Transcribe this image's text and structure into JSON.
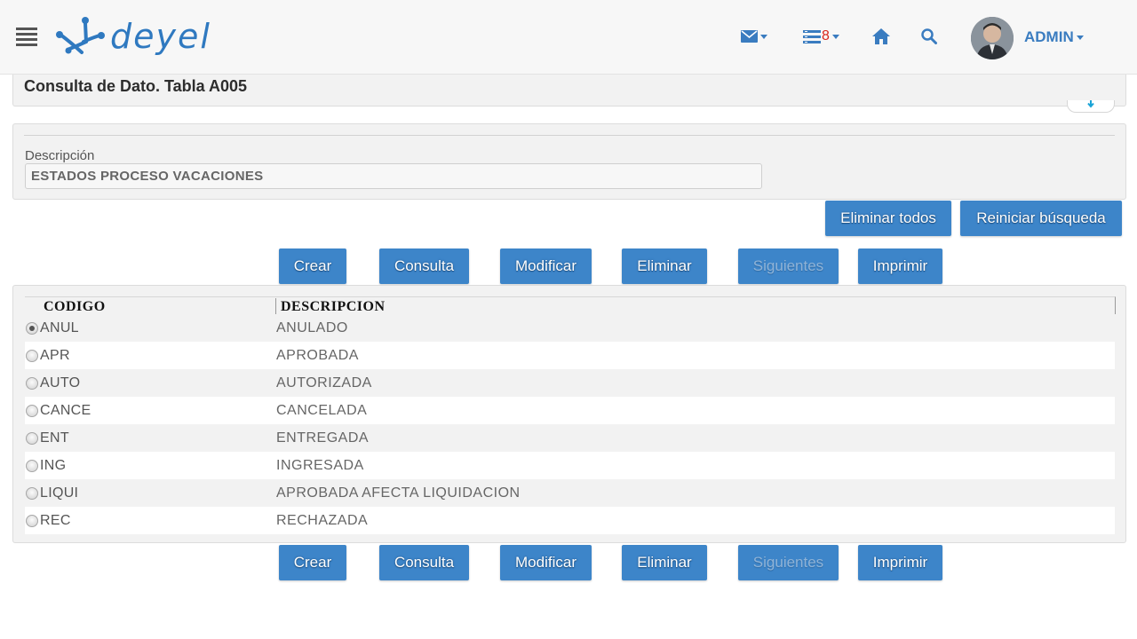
{
  "header": {
    "brand": "deyel",
    "messages_icon": "envelope-icon",
    "tasks_icon": "list-icon",
    "tasks_count": "8",
    "home_icon": "home-icon",
    "search_icon": "search-icon",
    "user_name": "ADMIN"
  },
  "page": {
    "title": "Consulta de Dato. Tabla A005"
  },
  "filter": {
    "label": "Descripción",
    "value": "ESTADOS PROCESO VACACIONES"
  },
  "filter_actions": {
    "delete_all": "Eliminar todos",
    "reset_search": "Reiniciar búsqueda"
  },
  "toolbar": {
    "create": "Crear",
    "query": "Consulta",
    "modify": "Modificar",
    "delete": "Eliminar",
    "next": "Siguientes",
    "print": "Imprimir"
  },
  "grid": {
    "columns": [
      "CODIGO",
      "DESCRIPCION"
    ],
    "selected_index": 0,
    "rows": [
      {
        "code": "ANUL",
        "description": "ANULADO"
      },
      {
        "code": "APR",
        "description": "APROBADA"
      },
      {
        "code": "AUTO",
        "description": "AUTORIZADA"
      },
      {
        "code": "CANCE",
        "description": "CANCELADA"
      },
      {
        "code": "ENT",
        "description": "ENTREGADA"
      },
      {
        "code": "ING",
        "description": "INGRESADA"
      },
      {
        "code": "LIQUI",
        "description": "APROBADA AFECTA LIQUIDACION"
      },
      {
        "code": "REC",
        "description": "RECHAZADA"
      }
    ]
  },
  "colors": {
    "accent": "#3d85c9",
    "badge": "#d9261c"
  }
}
